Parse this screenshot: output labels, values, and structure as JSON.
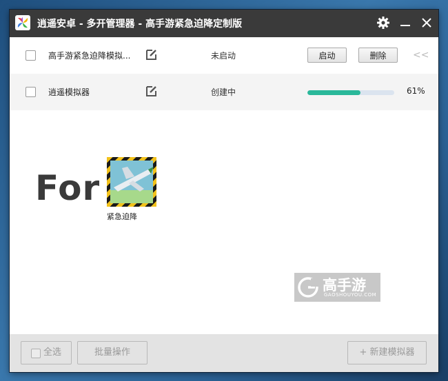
{
  "window": {
    "title": "逍遥安卓 - 多开管理器 - 高手游紧急迫降定制版",
    "icons": {
      "settings": "gear-icon",
      "minimize": "minimize-icon",
      "close": "close-icon"
    }
  },
  "emulators": [
    {
      "name": "高手游紧急迫降模拟...",
      "status": "未启动",
      "start_label": "启动",
      "delete_label": "删除",
      "collapse": "<<"
    },
    {
      "name": "逍遥模拟器",
      "status": "创建中",
      "progress": 0.61,
      "progress_label": "61%"
    }
  ],
  "promo": {
    "for_text": "For",
    "game_label": "紧急迫降"
  },
  "watermark": {
    "title": "高手游",
    "sub": "GAOSHOUYOU.COM"
  },
  "bottom": {
    "select_all": "全选",
    "batch": "批量操作",
    "new_emulator": "新建模拟器",
    "new_icon": "+"
  },
  "colors": {
    "titlebar": "#3a3a3a",
    "progress": "#2ab89a",
    "progress_track": "#dbe4ef"
  }
}
